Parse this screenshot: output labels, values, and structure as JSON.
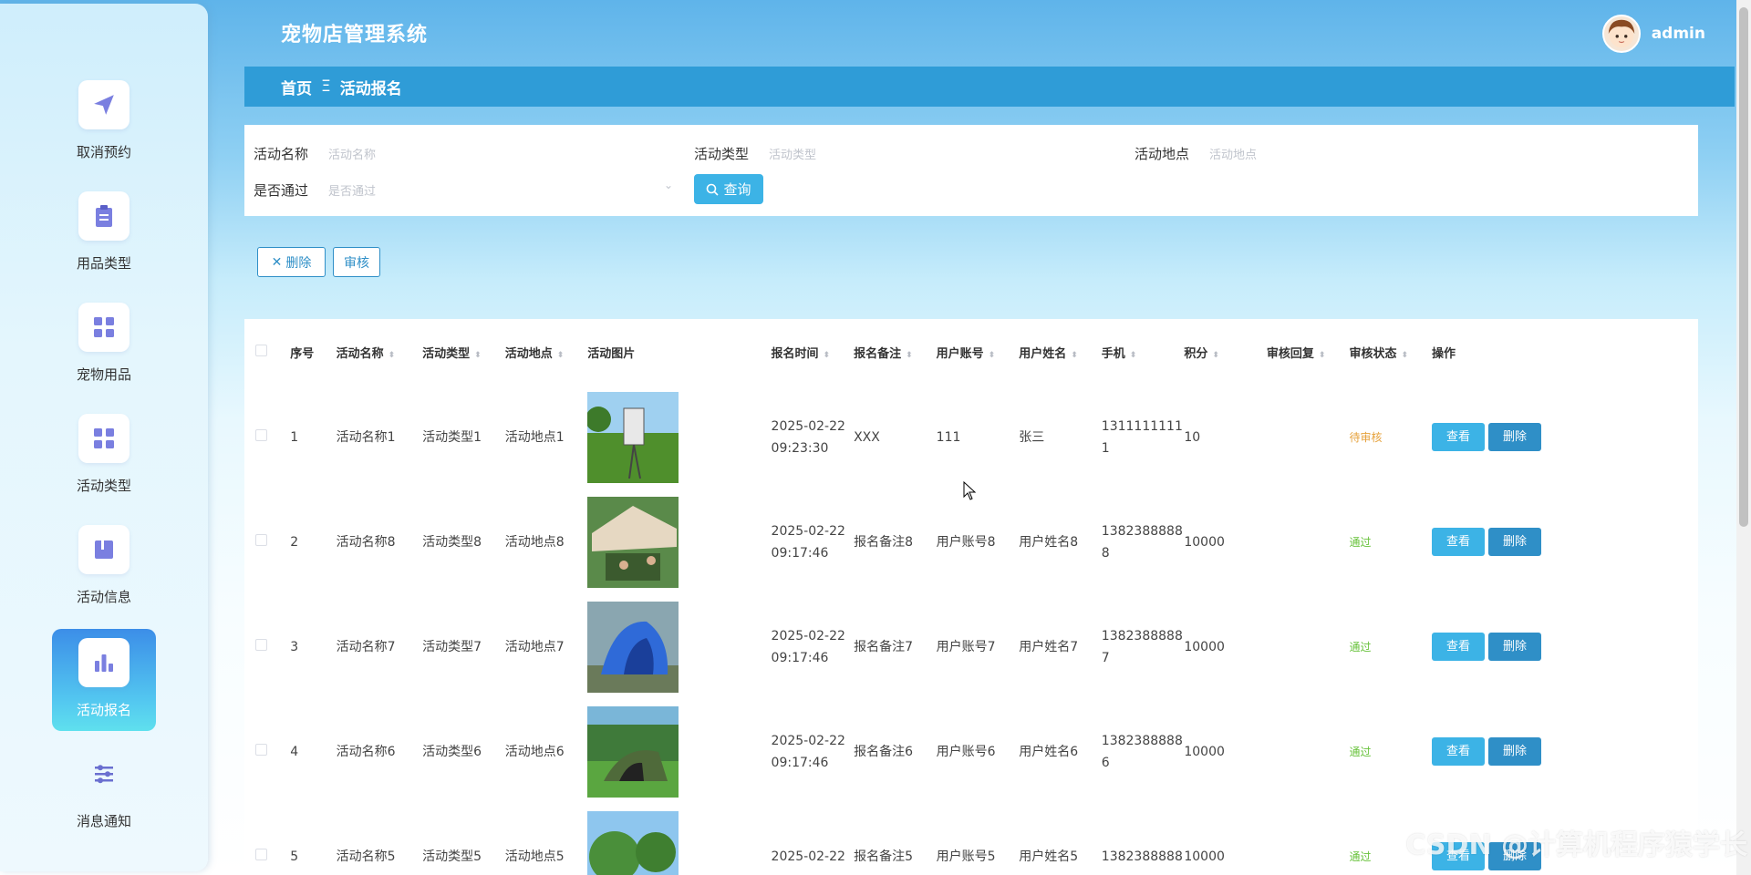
{
  "app_title": "宠物店管理系统",
  "user": {
    "name": "admin",
    "avatar_icon": "avatar-icon"
  },
  "breadcrumb": {
    "home": "首页",
    "sep": "Ξ",
    "current": "活动报名"
  },
  "sidebar": {
    "items": [
      {
        "label": "取消预约",
        "icon": "send-icon",
        "active": false
      },
      {
        "label": "用品类型",
        "icon": "clipboard-icon",
        "active": false
      },
      {
        "label": "宠物用品",
        "icon": "grid-icon",
        "active": false
      },
      {
        "label": "活动类型",
        "icon": "grid-icon",
        "active": false
      },
      {
        "label": "活动信息",
        "icon": "book-icon",
        "active": false
      },
      {
        "label": "活动报名",
        "icon": "bar-chart-icon",
        "active": true
      },
      {
        "label": "消息通知",
        "icon": "sliders-icon",
        "active": false
      }
    ]
  },
  "search": {
    "name_label": "活动名称",
    "name_placeholder": "活动名称",
    "type_label": "活动类型",
    "type_placeholder": "活动类型",
    "place_label": "活动地点",
    "place_placeholder": "活动地点",
    "pass_label": "是否通过",
    "pass_placeholder": "是否通过",
    "query_label": "查询"
  },
  "actions": {
    "delete_label": "删除",
    "review_label": "审核"
  },
  "table": {
    "headers": [
      "序号",
      "活动名称",
      "活动类型",
      "活动地点",
      "活动图片",
      "报名时间",
      "报名备注",
      "用户账号",
      "用户姓名",
      "手机",
      "积分",
      "审核回复",
      "审核状态",
      "操作"
    ],
    "rows": [
      {
        "no": "1",
        "name": "活动名称1",
        "type": "活动类型1",
        "place": "活动地点1",
        "date": "2025-02-22",
        "time": "09:23:30",
        "remark": "XXX",
        "account": "111",
        "uname": "张三",
        "phone1": "1311111111",
        "phone2": "1",
        "points": "10",
        "reply": "",
        "status": "待审核"
      },
      {
        "no": "2",
        "name": "活动名称8",
        "type": "活动类型8",
        "place": "活动地点8",
        "date": "2025-02-22",
        "time": "09:17:46",
        "remark": "报名备注8",
        "account": "用户账号8",
        "uname": "用户姓名8",
        "phone1": "1382388888",
        "phone2": "8",
        "points": "10000",
        "reply": "",
        "status": "通过"
      },
      {
        "no": "3",
        "name": "活动名称7",
        "type": "活动类型7",
        "place": "活动地点7",
        "date": "2025-02-22",
        "time": "09:17:46",
        "remark": "报名备注7",
        "account": "用户账号7",
        "uname": "用户姓名7",
        "phone1": "1382388888",
        "phone2": "7",
        "points": "10000",
        "reply": "",
        "status": "通过"
      },
      {
        "no": "4",
        "name": "活动名称6",
        "type": "活动类型6",
        "place": "活动地点6",
        "date": "2025-02-22",
        "time": "09:17:46",
        "remark": "报名备注6",
        "account": "用户账号6",
        "uname": "用户姓名6",
        "phone1": "1382388888",
        "phone2": "6",
        "points": "10000",
        "reply": "",
        "status": "通过"
      },
      {
        "no": "5",
        "name": "活动名称5",
        "type": "活动类型5",
        "place": "活动地点5",
        "date": "2025-02-22",
        "time": "",
        "remark": "报名备注5",
        "account": "用户账号5",
        "uname": "用户姓名5",
        "phone1": "1382388888",
        "phone2": "",
        "points": "10000",
        "reply": "",
        "status": "通过"
      }
    ],
    "view_label": "查看",
    "delete_label": "删除"
  },
  "colors": {
    "primary": "#3cb3e6",
    "header_bar": "#2f9cd7",
    "pending": "#e6a23c",
    "pass": "#67c23a"
  },
  "watermark": "CSDN @计算机程序猿学长"
}
